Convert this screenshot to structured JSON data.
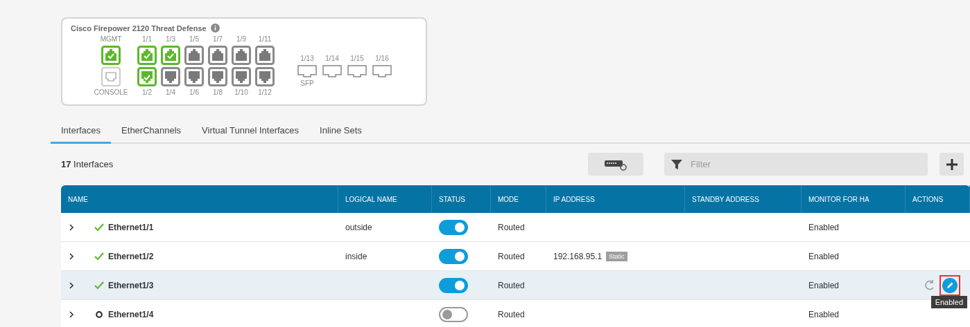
{
  "device": {
    "title": "Cisco Firepower 2120 Threat Defense",
    "mgmt": {
      "label": "MGMT",
      "up": true
    },
    "console": {
      "label": "CONSOLE"
    },
    "ports": [
      {
        "top": {
          "label": "1/1",
          "up": true
        },
        "bottom": {
          "label": "1/2",
          "up": true
        }
      },
      {
        "top": {
          "label": "1/3",
          "up": true
        },
        "bottom": {
          "label": "1/4",
          "up": false
        }
      },
      {
        "top": {
          "label": "1/5",
          "up": false
        },
        "bottom": {
          "label": "1/6",
          "up": false
        }
      },
      {
        "top": {
          "label": "1/7",
          "up": false
        },
        "bottom": {
          "label": "1/8",
          "up": false
        }
      },
      {
        "top": {
          "label": "1/9",
          "up": false
        },
        "bottom": {
          "label": "1/10",
          "up": false
        }
      },
      {
        "top": {
          "label": "1/11",
          "up": false
        },
        "bottom": {
          "label": "1/12",
          "up": false
        }
      }
    ],
    "sfp": {
      "labels": [
        "1/13",
        "1/14",
        "1/15",
        "1/16"
      ],
      "caption": "SFP"
    }
  },
  "tabs": [
    {
      "label": "Interfaces",
      "selected": true
    },
    {
      "label": "EtherChannels",
      "selected": false
    },
    {
      "label": "Virtual Tunnel Interfaces",
      "selected": false
    },
    {
      "label": "Inline Sets",
      "selected": false
    }
  ],
  "count": {
    "number": "17",
    "label": "Interfaces"
  },
  "filter": {
    "placeholder": "Filter"
  },
  "table": {
    "columns": [
      "NAME",
      "LOGICAL NAME",
      "STATUS",
      "MODE",
      "IP ADDRESS",
      "STANDBY ADDRESS",
      "MONITOR FOR HA",
      "ACTIONS"
    ],
    "rows": [
      {
        "name": "Ethernet1/1",
        "linked": true,
        "logical_name": "outside",
        "on": true,
        "mode": "Routed",
        "monitor": "Enabled",
        "selected": false
      },
      {
        "name": "Ethernet1/2",
        "linked": true,
        "logical_name": "inside",
        "on": true,
        "mode": "Routed",
        "ip": "192.168.95.1",
        "ip_tag": "Static",
        "monitor": "Enabled",
        "selected": false
      },
      {
        "name": "Ethernet1/3",
        "linked": true,
        "on": true,
        "mode": "Routed",
        "monitor": "Enabled",
        "selected": true,
        "tooltip": "Enabled"
      },
      {
        "name": "Ethernet1/4",
        "linked": false,
        "on": false,
        "mode": "Routed",
        "monitor": "Enabled",
        "selected": false
      }
    ]
  }
}
